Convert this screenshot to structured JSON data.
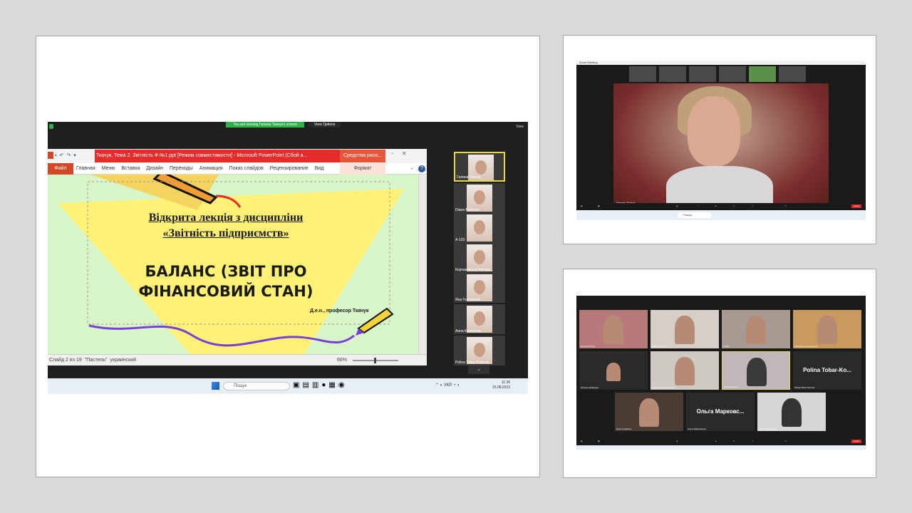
{
  "main": {
    "share_banner": "You are viewing Галина Ткачук's screen",
    "view_options": "View Options",
    "view_btn": "View",
    "ppt": {
      "window_title": "Ткачук, Тема 2. Звітність Ф №1.ppt [Режим совместимости] - Microsoft PowerPoint (Сбой а...",
      "tools_tab": "Средства рисо...",
      "file_tab": "Файл",
      "tabs": [
        "Главная",
        "Меню",
        "Вставка",
        "Дизайн",
        "Переходы",
        "Анимация",
        "Показ слайдов",
        "Рецензирование",
        "Вид"
      ],
      "format_tab": "Формат",
      "slide_line1": "Відкрита лекція з дисципліни",
      "slide_line2": "«Звітність підприємств»",
      "slide_title1": "БАЛАНС (ЗВІТ ПРО",
      "slide_title2": "ФІНАНСОВИЙ СТАН)",
      "slide_author": "Д.е.н., професор Ткачук",
      "status_slide": "Слайд 2 из 19",
      "status_theme": "\"Пастель\"",
      "status_lang": "украинский",
      "zoom_pct": "66%"
    },
    "participants": [
      {
        "name": "Галина Ткачук",
        "active": true
      },
      {
        "name": "Diana Markova",
        "active": false
      },
      {
        "name": "А-103",
        "active": false
      },
      {
        "name": "Корчаковська Катери...",
        "active": false
      },
      {
        "name": "Яна Головатюк",
        "active": false
      },
      {
        "name": "Анна Калинина",
        "active": false
      },
      {
        "name": "Polina Tobar-Kobrera",
        "active": false
      }
    ],
    "taskbar": {
      "search_placeholder": "Пошук",
      "tray": "УКР",
      "time": "11:36",
      "date": "15.08.2023"
    }
  },
  "top": {
    "title": "Zoom Meeting",
    "speaker_name": "Галина Ткачук",
    "search": "Пошук",
    "leave": "Leave"
  },
  "bottom": {
    "tiles": [
      {
        "name": "Галина Ткачук"
      },
      {
        "name": "Diana Markova"
      },
      {
        "name": "A-103"
      },
      {
        "name": "Корчаковська Катерина"
      },
      {
        "name": "Ксюша Назаренко"
      },
      {
        "name": "Корчаковська Катерина"
      },
      {
        "name": "Галина Ткачук"
      },
      {
        "name": "Polina Tobar-Kobrera"
      },
      {
        "name": "Яна Головатюк"
      },
      {
        "name": "Ольга Марковська"
      },
      {
        "name": "Христя Бондарчук"
      }
    ],
    "namecard1": "Polina Tobar-Ko...",
    "namecard2": "Ольга Марковс...",
    "leave": "Leave"
  },
  "colors": {
    "background": "#d9d9d9",
    "zoom_dark": "#1f1f1f",
    "ppt_red": "#e52b2b",
    "highlight": "#e6d93a",
    "share_green": "#2db34a"
  }
}
